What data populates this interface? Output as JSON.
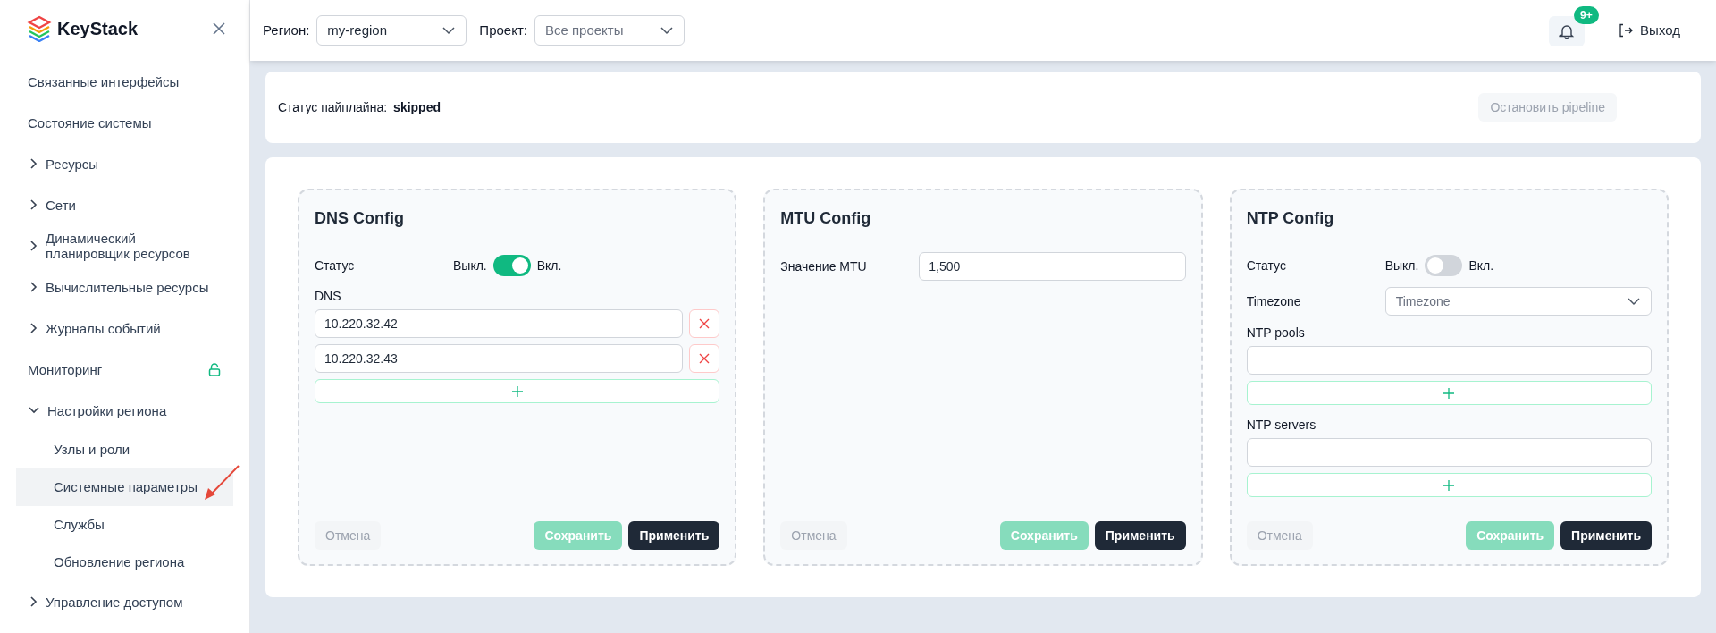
{
  "sidebar": {
    "logo_text": "KeyStack",
    "items": [
      {
        "label": "Связанные интерфейсы",
        "kind": "plain"
      },
      {
        "label": "Состояние системы",
        "kind": "plain"
      },
      {
        "label": "Ресурсы",
        "kind": "group",
        "expanded": false
      },
      {
        "label": "Сети",
        "kind": "group",
        "expanded": false
      },
      {
        "label": "Динамический планировщик ресурсов",
        "kind": "group",
        "expanded": false
      },
      {
        "label": "Вычислительные ресурсы",
        "kind": "group",
        "expanded": false
      },
      {
        "label": "Журналы событий",
        "kind": "group",
        "expanded": false
      },
      {
        "label": "Мониторинг",
        "kind": "lock"
      },
      {
        "label": "Настройки региона",
        "kind": "group",
        "expanded": true,
        "children": [
          {
            "label": "Узлы и роли",
            "selected": false
          },
          {
            "label": "Системные параметры",
            "selected": true
          },
          {
            "label": "Службы",
            "selected": false
          },
          {
            "label": "Обновление региона",
            "selected": false
          }
        ]
      },
      {
        "label": "Управление доступом",
        "kind": "group",
        "expanded": false
      }
    ]
  },
  "topbar": {
    "region": {
      "label": "Регион:",
      "value": "my-region"
    },
    "project": {
      "label": "Проект:",
      "placeholder": "Все проекты"
    },
    "notifications": {
      "badge": "9+"
    },
    "logout": "Выход"
  },
  "pipeline": {
    "label": "Статус пайплайна:",
    "value": "skipped",
    "stop_button": {
      "label": "Остановить pipeline",
      "disabled": true
    }
  },
  "cards": [
    {
      "title": "DNS Config",
      "fields": [
        {
          "kind": "toggle",
          "label": "Статус",
          "off_label": "Выкл.",
          "on_label": "Вкл.",
          "on": true
        },
        {
          "kind": "list",
          "label": "DNS",
          "items": [
            "10.220.32.42",
            "10.220.32.43"
          ]
        }
      ],
      "buttons": [
        {
          "label": "Отмена",
          "kind": "cancel",
          "disabled": true
        },
        {
          "label": "Сохранить",
          "kind": "save",
          "disabled": true
        },
        {
          "label": "Применить",
          "kind": "apply",
          "disabled": false
        }
      ]
    },
    {
      "title": "MTU Config",
      "fields": [
        {
          "kind": "input",
          "label": "Значение MTU",
          "value": "1,500"
        }
      ],
      "buttons": [
        {
          "label": "Отмена",
          "kind": "cancel",
          "disabled": true
        },
        {
          "label": "Сохранить",
          "kind": "save",
          "disabled": true
        },
        {
          "label": "Применить",
          "kind": "apply",
          "disabled": false
        }
      ]
    },
    {
      "title": "NTP Config",
      "fields": [
        {
          "kind": "toggle",
          "label": "Статус",
          "off_label": "Выкл.",
          "on_label": "Вкл.",
          "on": false
        },
        {
          "kind": "select",
          "label": "Timezone",
          "placeholder": "Timezone"
        },
        {
          "kind": "list",
          "label": "NTP pools"
        },
        {
          "kind": "list",
          "label": "NTP servers"
        }
      ],
      "buttons": [
        {
          "label": "Отмена",
          "kind": "cancel",
          "disabled": true
        },
        {
          "label": "Сохранить",
          "kind": "save",
          "disabled": true
        },
        {
          "label": "Применить",
          "kind": "apply",
          "disabled": false
        }
      ]
    }
  ]
}
